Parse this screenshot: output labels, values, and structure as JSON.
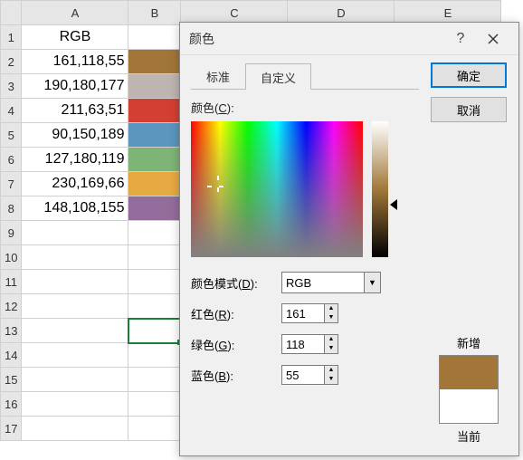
{
  "sheet": {
    "col_headers": [
      "A",
      "B",
      "C",
      "D",
      "E"
    ],
    "row_headers": [
      "1",
      "2",
      "3",
      "4",
      "5",
      "6",
      "7",
      "8",
      "9",
      "10",
      "11",
      "12",
      "13",
      "14",
      "15",
      "16",
      "17"
    ],
    "a1": "RGB",
    "rows": [
      {
        "rgb": "161,118,55",
        "color": "#a17638"
      },
      {
        "rgb": "190,180,177",
        "color": "#beb4b1"
      },
      {
        "rgb": "211,63,51",
        "color": "#d33f33"
      },
      {
        "rgb": "90,150,189",
        "color": "#5a96bd"
      },
      {
        "rgb": "127,180,119",
        "color": "#7fb477"
      },
      {
        "rgb": "230,169,66",
        "color": "#e6a942"
      },
      {
        "rgb": "148,108,155",
        "color": "#946c9b"
      }
    ],
    "selected_cell": "B13"
  },
  "dialog": {
    "title": "颜色",
    "help": "?",
    "tabs": {
      "standard": "标准",
      "custom": "自定义"
    },
    "labels": {
      "color": "颜色(",
      "color_u": "C",
      "color_end": "):",
      "mode": "颜色模式(",
      "mode_u": "D",
      "mode_end": "):",
      "red": "红色(",
      "red_u": "R",
      "red_end": "):",
      "green": "绿色(",
      "green_u": "G",
      "green_end": "):",
      "blue": "蓝色(",
      "blue_u": "B",
      "blue_end": "):"
    },
    "mode_value": "RGB",
    "values": {
      "r": "161",
      "g": "118",
      "b": "55"
    },
    "buttons": {
      "ok": "确定",
      "cancel": "取消"
    },
    "preview": {
      "new_label": "新增",
      "current_label": "当前",
      "new_color": "#a17638",
      "current_color": "#ffffff"
    }
  }
}
